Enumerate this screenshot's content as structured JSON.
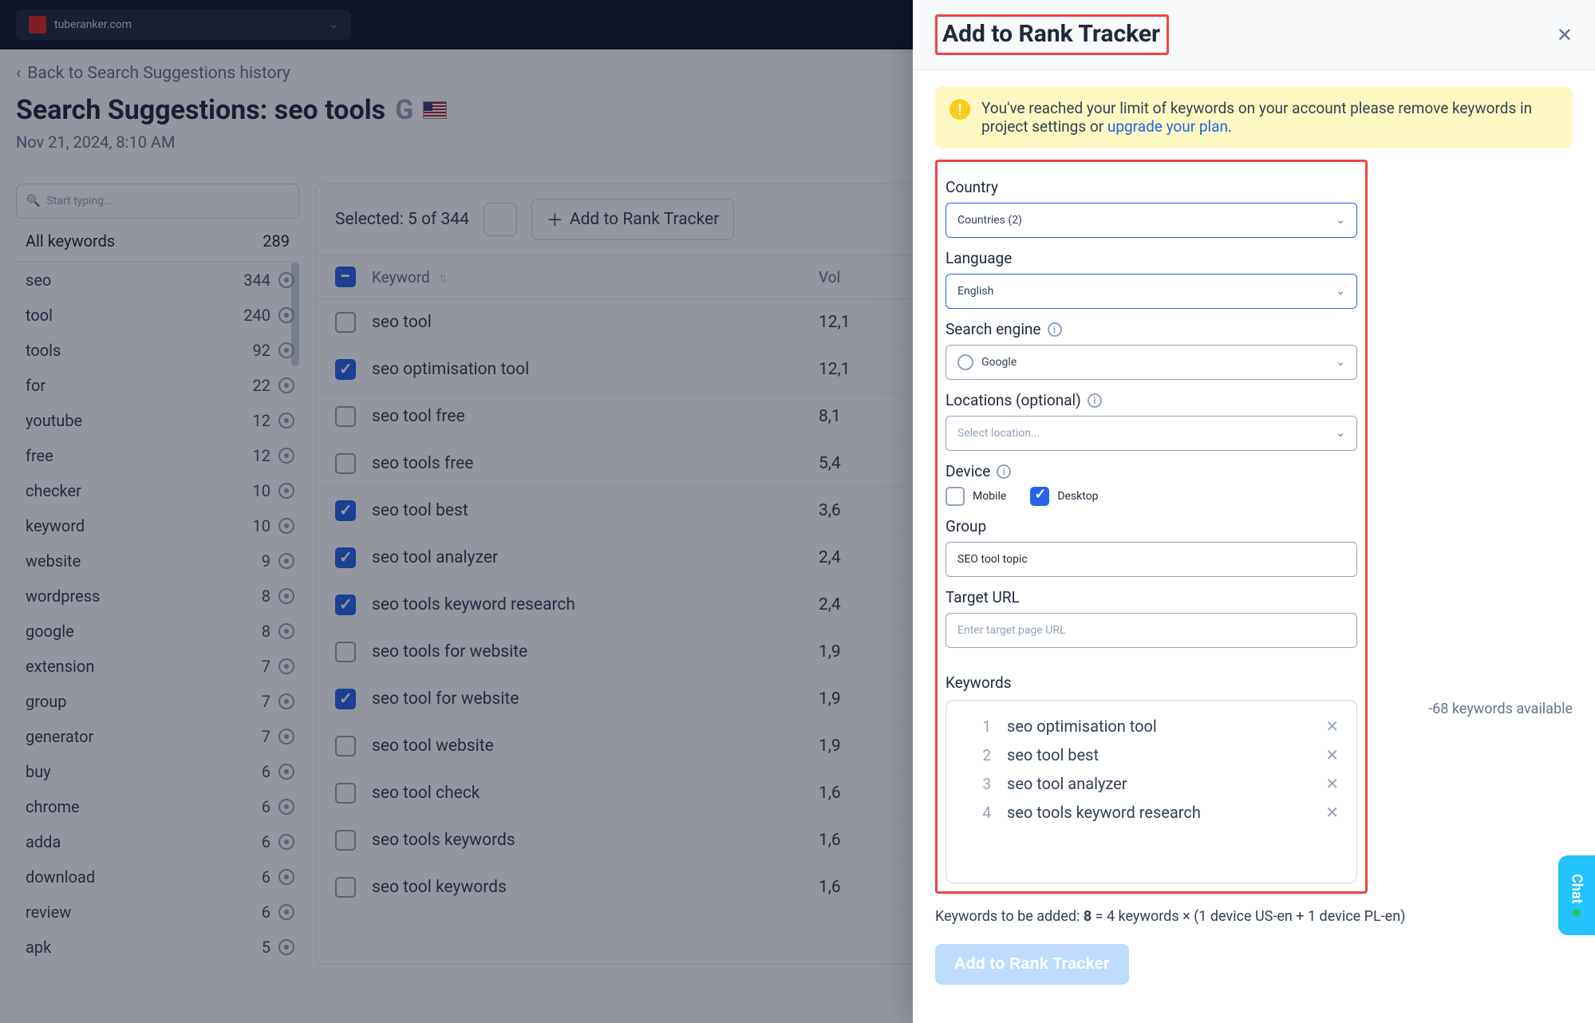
{
  "topbar": {
    "site": "tuberanker.com"
  },
  "back_link": "Back to Search Suggestions history",
  "page": {
    "title": "Search Suggestions: seo tools",
    "timestamp": "Nov 21, 2024, 8:10 AM"
  },
  "search_placeholder": "Start typing...",
  "all_keywords": {
    "label": "All keywords",
    "count": "289"
  },
  "sidebar_keywords": [
    {
      "kw": "seo",
      "n": "344"
    },
    {
      "kw": "tool",
      "n": "240"
    },
    {
      "kw": "tools",
      "n": "92"
    },
    {
      "kw": "for",
      "n": "22"
    },
    {
      "kw": "youtube",
      "n": "12"
    },
    {
      "kw": "free",
      "n": "12"
    },
    {
      "kw": "checker",
      "n": "10"
    },
    {
      "kw": "keyword",
      "n": "10"
    },
    {
      "kw": "website",
      "n": "9"
    },
    {
      "kw": "wordpress",
      "n": "8"
    },
    {
      "kw": "google",
      "n": "8"
    },
    {
      "kw": "extension",
      "n": "7"
    },
    {
      "kw": "group",
      "n": "7"
    },
    {
      "kw": "generator",
      "n": "7"
    },
    {
      "kw": "buy",
      "n": "6"
    },
    {
      "kw": "chrome",
      "n": "6"
    },
    {
      "kw": "adda",
      "n": "6"
    },
    {
      "kw": "download",
      "n": "6"
    },
    {
      "kw": "review",
      "n": "6"
    },
    {
      "kw": "apk",
      "n": "5"
    }
  ],
  "toolbar": {
    "selected_text": "Selected: 5 of 344",
    "add_label": "Add to Rank Tracker"
  },
  "table": {
    "col_keyword": "Keyword",
    "col_volume": "Vol",
    "rows": [
      {
        "checked": false,
        "kw": "seo tool",
        "vol": "12,1"
      },
      {
        "checked": true,
        "kw": "seo optimisation tool",
        "vol": "12,1"
      },
      {
        "checked": false,
        "kw": "seo tool free",
        "vol": "8,1"
      },
      {
        "checked": false,
        "kw": "seo tools free",
        "vol": "5,4"
      },
      {
        "checked": true,
        "kw": "seo tool best",
        "vol": "3,6"
      },
      {
        "checked": true,
        "kw": "seo tool analyzer",
        "vol": "2,4"
      },
      {
        "checked": true,
        "kw": "seo tools keyword research",
        "vol": "2,4"
      },
      {
        "checked": false,
        "kw": "seo tools for website",
        "vol": "1,9"
      },
      {
        "checked": true,
        "kw": "seo tool for website",
        "vol": "1,9"
      },
      {
        "checked": false,
        "kw": "seo tool website",
        "vol": "1,9"
      },
      {
        "checked": false,
        "kw": "seo tool check",
        "vol": "1,6"
      },
      {
        "checked": false,
        "kw": "seo tools keywords",
        "vol": "1,6"
      },
      {
        "checked": false,
        "kw": "seo tool keywords",
        "vol": "1,6"
      }
    ]
  },
  "panel": {
    "title": "Add to Rank Tracker",
    "alert_text_1": "You've reached your limit of keywords on your account please remove keywords in project settings or ",
    "alert_link": "upgrade your plan",
    "labels": {
      "country": "Country",
      "language": "Language",
      "search_engine": "Search engine",
      "locations": "Locations (optional)",
      "device": "Device",
      "group": "Group",
      "target_url": "Target URL",
      "keywords": "Keywords"
    },
    "values": {
      "country": "Countries (2)",
      "language": "English",
      "search_engine": "Google",
      "locations_placeholder": "Select location...",
      "mobile": "Mobile",
      "desktop": "Desktop",
      "group_value": "SEO tool topic",
      "target_url_placeholder": "Enter target page URL"
    },
    "keywords_available": "-68 keywords available",
    "keyword_list": [
      "seo optimisation tool",
      "seo tool best",
      "seo tool analyzer",
      "seo tools keyword research"
    ],
    "footer_label": "Keywords to be added:",
    "footer_count": "8",
    "footer_rest": " = 4 keywords × (1 device US-en + 1 device PL-en)",
    "submit": "Add to Rank Tracker"
  },
  "chat_label": "Chat"
}
